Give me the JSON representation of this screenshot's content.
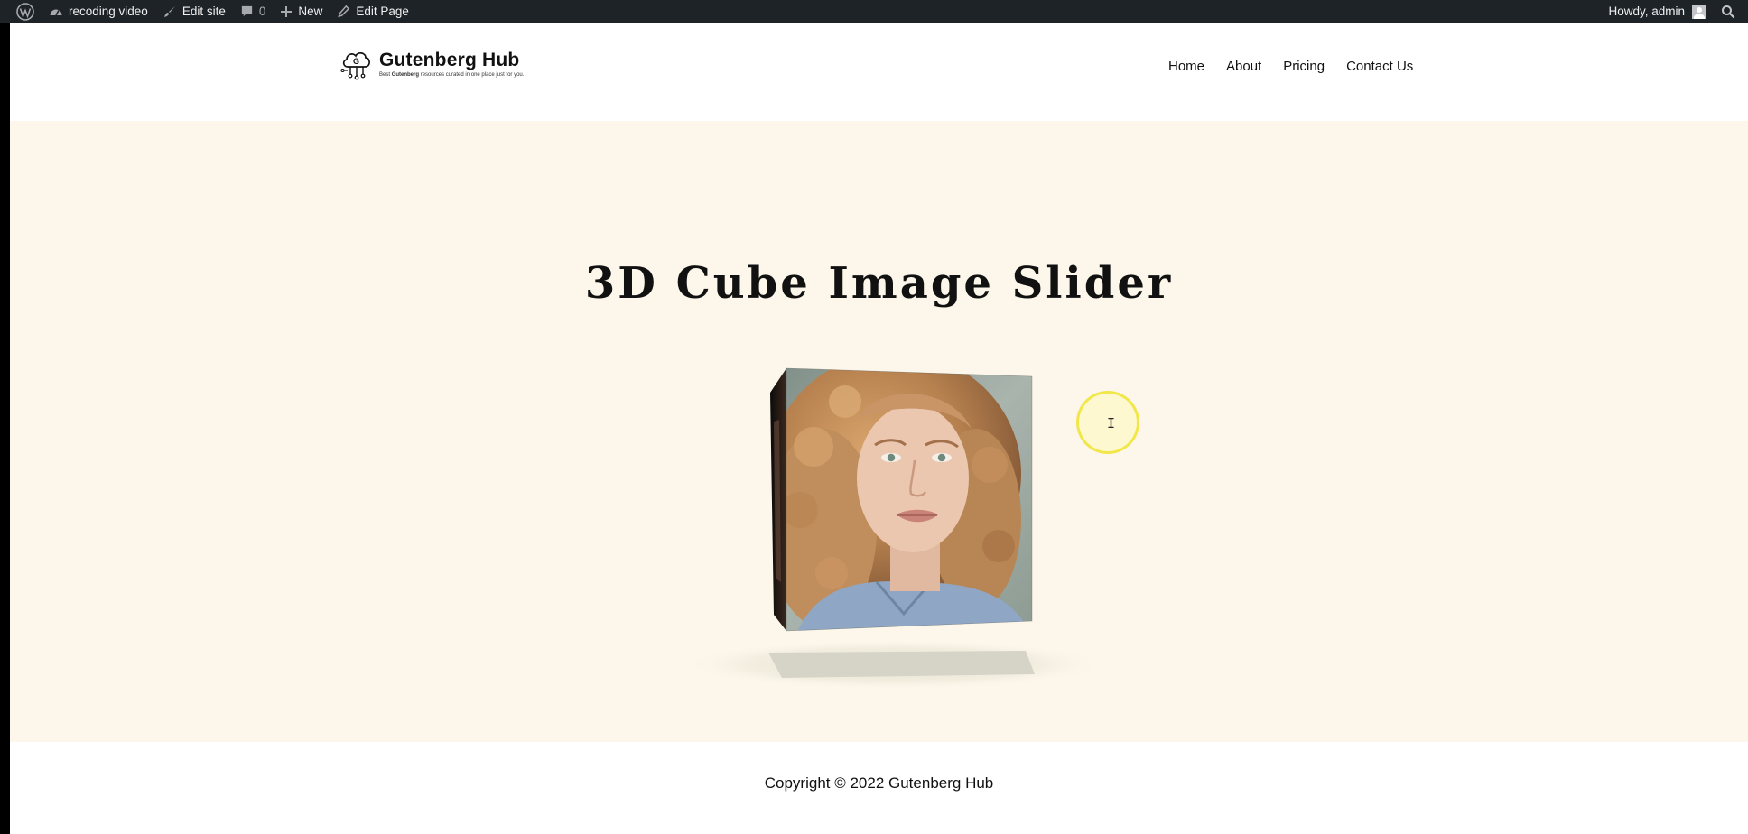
{
  "admin_bar": {
    "site_name": "recoding video",
    "edit_site": "Edit site",
    "comments_count": "0",
    "new_label": "New",
    "edit_page": "Edit Page",
    "howdy": "Howdy, admin"
  },
  "header": {
    "brand": "Gutenberg Hub",
    "tagline_pre": "Best ",
    "tagline_bold": "Gutenberg",
    "tagline_post": " resources curated in one place just for you.",
    "nav": [
      "Home",
      "About",
      "Pricing",
      "Contact Us"
    ]
  },
  "hero": {
    "title": "3D Cube Image Slider"
  },
  "footer": {
    "copyright": "Copyright © 2022 Gutenberg Hub"
  },
  "colors": {
    "admin_bar_bg": "#1d2327",
    "hero_bg": "#fcf7ea",
    "cursor_highlight": "#f0e63c"
  }
}
